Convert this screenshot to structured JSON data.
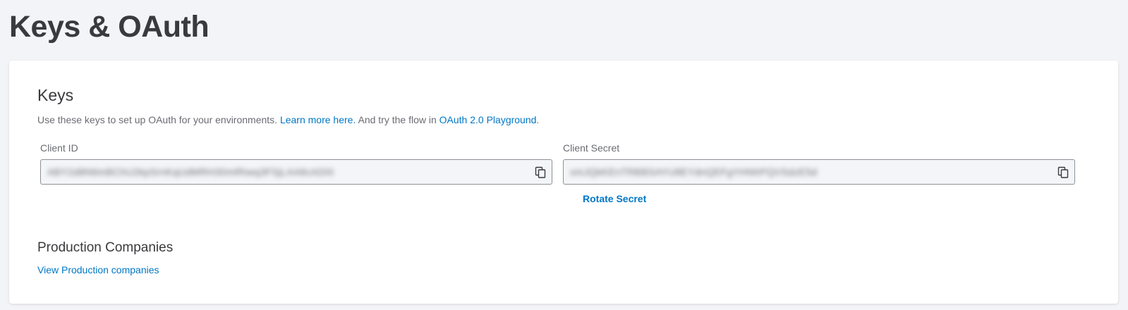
{
  "page": {
    "title": "Keys & OAuth"
  },
  "keys": {
    "title": "Keys",
    "description": {
      "prefix": "Use these keys to set up OAuth for your environments. ",
      "learn_more": "Learn more here.",
      "middle": " And try the flow in ",
      "playground": "OAuth 2.0 Playground",
      "suffix": "."
    },
    "client_id": {
      "label": "Client ID",
      "value": "ABY2d8N6mBChU2kpSrnKqUdMRH30mlRiwq3FSjLAA8cAD0I",
      "icon": "copy-icon"
    },
    "client_secret": {
      "label": "Client Secret",
      "value": "xmJQkKEnTRBBSAYU8EYdnQEFgYHNhPQVSdzE5d",
      "icon": "copy-icon"
    },
    "rotate_label": "Rotate Secret"
  },
  "production": {
    "title": "Production Companies",
    "link": "View Production companies"
  },
  "colors": {
    "link": "#0077c5",
    "text": "#393a3d",
    "muted": "#6b6c72",
    "background": "#f3f4f7"
  }
}
